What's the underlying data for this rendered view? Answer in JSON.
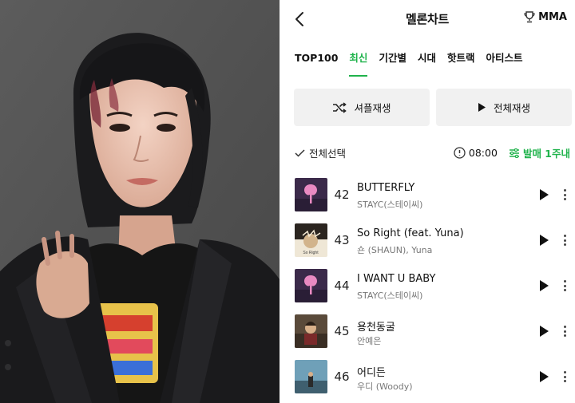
{
  "header": {
    "title": "멜론차트",
    "mma_label": "MMA"
  },
  "tabs": [
    {
      "label": "TOP100",
      "active": false
    },
    {
      "label": "최신",
      "active": true
    },
    {
      "label": "기간별",
      "active": false
    },
    {
      "label": "시대",
      "active": false
    },
    {
      "label": "핫트랙",
      "active": false
    },
    {
      "label": "아티스트",
      "active": false
    }
  ],
  "actions": {
    "shuffle_label": "셔플재생",
    "play_all_label": "전체재생"
  },
  "selection": {
    "select_all_label": "전체선택",
    "time": "08:00",
    "filter_label": "발매 1주내"
  },
  "songs": [
    {
      "rank": "42",
      "title": "BUTTERFLY",
      "artist": "STAYC(스테이씨)"
    },
    {
      "rank": "43",
      "title": "So Right (feat. Yuna)",
      "artist": "숀 (SHAUN), Yuna"
    },
    {
      "rank": "44",
      "title": "I WANT U BABY",
      "artist": "STAYC(스테이씨)"
    },
    {
      "rank": "45",
      "title": "용천동굴",
      "artist": "안예은"
    },
    {
      "rank": "46",
      "title": "어디든",
      "artist": "우디 (Woody)"
    }
  ],
  "colors": {
    "accent": "#20b34c",
    "button_bg": "#f1f1f1",
    "text": "#111111",
    "subtext": "#777777"
  },
  "icons": [
    "chevron-left-icon",
    "trophy-icon",
    "shuffle-icon",
    "play-icon",
    "check-icon",
    "clock-icon",
    "filter-icon",
    "more-vertical-icon"
  ]
}
